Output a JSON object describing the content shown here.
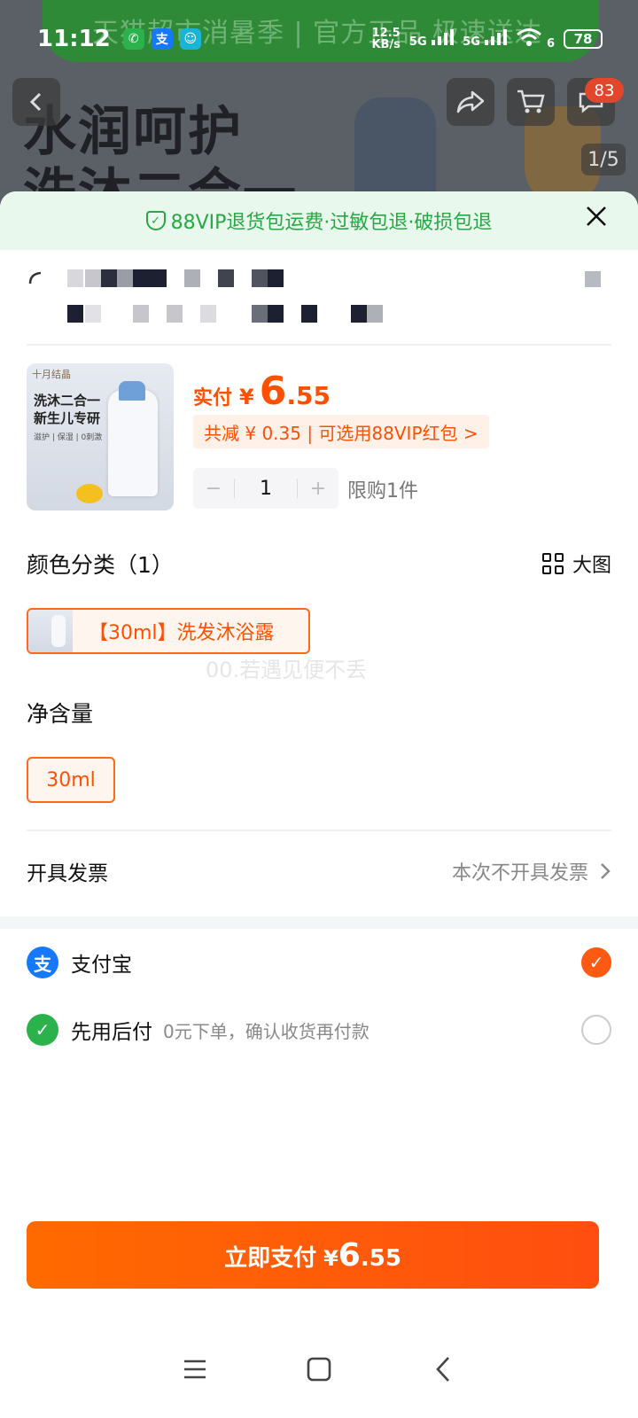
{
  "status_bar": {
    "time": "11:12",
    "speed_value": "12.5",
    "speed_unit": "KB/s",
    "net1": "5G",
    "net2": "5G",
    "wifi_sub": "6",
    "battery": "78"
  },
  "background_page": {
    "banner_text": "天猫超市消暑季 | 官方正品 极速送达",
    "headline_line1": "水润呵护",
    "headline_line2": "洗沐二合一",
    "cart_badge": "83",
    "image_counter": "1/5"
  },
  "sheet": {
    "vip_notice": "88VIP退货包运费·过敏包退·破损包退",
    "product": {
      "image_brand": "十月结晶",
      "image_title_1": "洗沐二合一",
      "image_title_2": "新生儿专研",
      "image_tags": "滋护 | 保湿 | 0刺激",
      "pay_label": "实付",
      "currency": "¥",
      "price_int": "6",
      "price_dec": ".55",
      "discount_text": "共减 ¥ 0.35 | 可选用88VIP红包 >",
      "quantity": "1",
      "minus": "−",
      "plus": "+",
      "limit_text": "限购1件"
    },
    "color_section": {
      "title": "颜色分类（1）",
      "big_image_label": "大图",
      "selected_option": "【30ml】洗发沐浴露"
    },
    "watermark": "00.若遇见便不丢",
    "size_section": {
      "title": "净含量",
      "selected_option": "30ml"
    },
    "invoice": {
      "label": "开具发票",
      "value": "本次不开具发票"
    },
    "payment_methods": [
      {
        "name": "支付宝",
        "subtitle": "",
        "selected": true,
        "color": "#1677ff",
        "icon": "alipay-icon"
      },
      {
        "name": "先用后付",
        "subtitle": "0元下单，确认收货再付款",
        "selected": false,
        "color": "#2bb24c",
        "icon": "pay-later-icon"
      }
    ],
    "pay_button": {
      "label": "立即支付",
      "currency": "¥",
      "price_int": "6",
      "price_dec": ".55"
    }
  },
  "colors": {
    "accent": "#ff5000",
    "vip_green": "#28a745"
  }
}
